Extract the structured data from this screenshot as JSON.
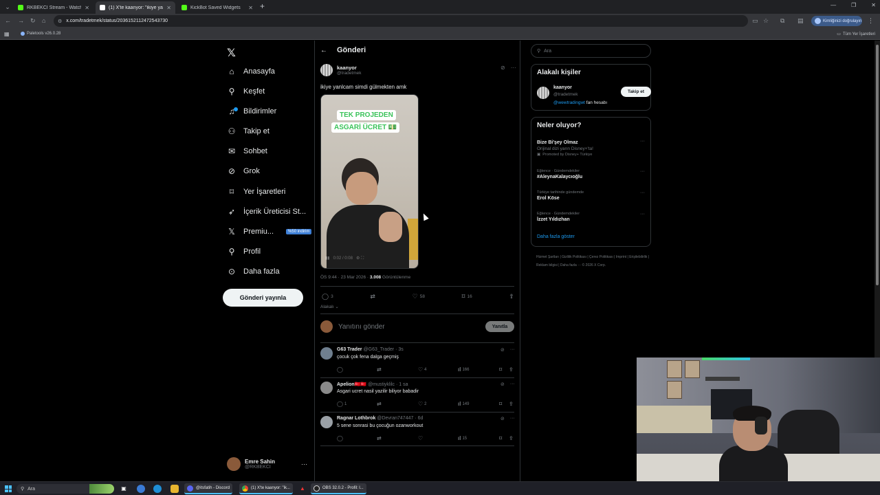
{
  "browser": {
    "tabs": [
      {
        "title": "RKBEKCI Stream - Watch Live o",
        "color": "#53fc18",
        "active": false
      },
      {
        "title": "(1) X'te kaanyor: \"ikiye yanı",
        "color": "#ffffff",
        "active": true
      },
      {
        "title": "KickBot Saved Widgets",
        "color": "#53fc18",
        "active": false
      }
    ],
    "url": "x.com/tradetmek/status/2036152112472543730",
    "profile_label": "Kimliğinizi doğrulayın",
    "bookmark_item": "Paletools v26.0.28",
    "all_bookmarks": "Tüm Yer İşaretleri"
  },
  "sidebar": {
    "items": [
      {
        "label": "Anasayfa",
        "icon": "home-icon",
        "glyph": "⌂"
      },
      {
        "label": "Keşfet",
        "icon": "search-icon",
        "glyph": "⚲"
      },
      {
        "label": "Bildirimler",
        "icon": "bell-icon",
        "glyph": "🔔"
      },
      {
        "label": "Takip et",
        "icon": "follow-icon",
        "glyph": "👤"
      },
      {
        "label": "Sohbet",
        "icon": "mail-icon",
        "glyph": "✉"
      },
      {
        "label": "Grok",
        "icon": "grok-icon",
        "glyph": "⊘"
      },
      {
        "label": "Yer İşaretleri",
        "icon": "bookmark-icon",
        "glyph": "🔖"
      },
      {
        "label": "İçerik Üreticisi St...",
        "icon": "rocket-icon",
        "glyph": "🚀"
      },
      {
        "label": "Premiu...",
        "icon": "x-icon",
        "glyph": "𝕏",
        "promo": "%50 indirim"
      },
      {
        "label": "Profil",
        "icon": "profile-icon",
        "glyph": "👤"
      },
      {
        "label": "Daha fazla",
        "icon": "more-icon",
        "glyph": "⊙"
      }
    ],
    "post_button": "Gönderi yayınla",
    "account": {
      "name": "Emre Sahin",
      "handle": "@RKBEKCI"
    }
  },
  "main": {
    "header_title": "Gönderi",
    "tweet": {
      "name": "kaanyor",
      "handle": "@tradetmek",
      "text": "ikiye yanlcam simdi gülmekten amk",
      "video_caption_1": "TEK PROJEDEN",
      "video_caption_2": "ASGARİ ÜCRET 💵",
      "video_time": "0:02 / 0:08",
      "time": "ÖS 9:44 · 23 Mar 2026 · ",
      "views": "3.008",
      "views_label": " Görüntülenme",
      "replies": "3",
      "retweets": "",
      "likes": "58",
      "bookmarks": "16",
      "related": "Alakalı ⌄"
    },
    "reply_placeholder": "Yanıtını gönder",
    "reply_button": "Yanıtla",
    "replies": [
      {
        "name": "G63 Trader",
        "handle": "@G63_Trader · 3s",
        "text": "çocuk çok fena dalga geçmiş",
        "replies": "",
        "retweets": "",
        "likes": "4",
        "views": "166"
      },
      {
        "name": "Apelion🇹🇷🇹🇷",
        "handle": "@mustiyklilc · 1 sa",
        "text": "Asgari ucret nasil yazilir biliyor babadir",
        "replies": "1",
        "retweets": "",
        "likes": "2",
        "views": "149"
      },
      {
        "name": "Ragnar Lothbrok",
        "handle": "@Devran747447 · 6d",
        "text": "5 sene sonrasi bu çocuğun ozanworkout",
        "replies": "",
        "retweets": "",
        "likes": "",
        "views": "15"
      }
    ]
  },
  "right": {
    "search_placeholder": "Ara",
    "related_title": "Alakalı kişiler",
    "person": {
      "name": "kaanyor",
      "handle": "@tradetmek",
      "bio_link": "@wewtradingwt",
      "bio_rest": " fan hesabı",
      "follow": "Takip et"
    },
    "trends_title": "Neler oluyor?",
    "trends": [
      {
        "category": "",
        "name": "Bize Bi'şey Olmaz",
        "sub": "Orijinal dizi yarın Disney+'ta!",
        "promo": "Promoted by Disney+ Türkiye"
      },
      {
        "category": "Eğlence · Gündemdekiler",
        "name": "#AleynaKalaycıoğlu",
        "sub": "",
        "promo": ""
      },
      {
        "category": "Türkiye tarihinde gündemde",
        "name": "Erol Köse",
        "sub": "",
        "promo": ""
      },
      {
        "category": "Eğlence · Gündemdekiler",
        "name": "İzzet Yıldızhan",
        "sub": "",
        "promo": ""
      }
    ],
    "show_more": "Daha fazla göster",
    "footer": "Hizmet Şartları  |  Gizlilik Politikası  |  Çerez Politikası  |  Imprint  |  Erişilebilirlik  |  Reklam bilgisi  |  Daha fazla ···  © 2026 X Corp."
  },
  "taskbar": {
    "search": "Ara",
    "apps": [
      {
        "label": "@itsfatih - Discord",
        "color": "#5865f2"
      },
      {
        "label": "(1) X'te kaanyor: \"ik...",
        "color": "#ffffff"
      },
      {
        "label": "OBS 32.0.2 - Profil: l...",
        "color": "#444"
      }
    ]
  }
}
